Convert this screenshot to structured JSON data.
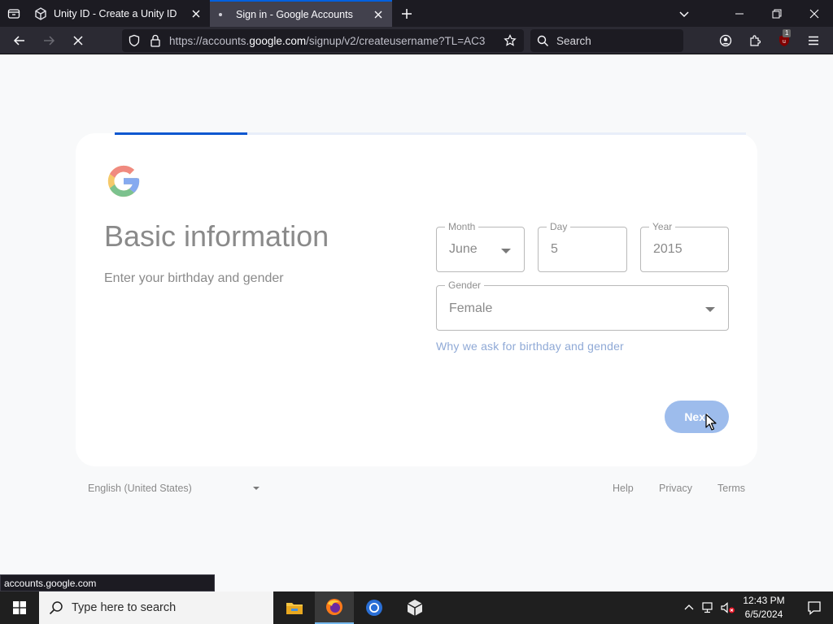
{
  "browser": {
    "tabs": [
      {
        "title": "Unity ID - Create a Unity ID",
        "icon": "unity-icon",
        "active": false
      },
      {
        "title": "Sign in - Google Accounts",
        "icon": "loading-dot-icon",
        "active": true
      }
    ],
    "url_prefix": "https://accounts.",
    "url_domain": "google.com",
    "url_suffix": "/signup/v2/createusername?TL=AC3",
    "search_placeholder": "Search",
    "extension_badge": "1",
    "status_url": "accounts.google.com"
  },
  "page": {
    "heading": "Basic information",
    "subheading": "Enter your birthday and gender",
    "progress_fraction": 0.21,
    "month": {
      "label": "Month",
      "value": "June"
    },
    "day": {
      "label": "Day",
      "value": "5"
    },
    "year": {
      "label": "Year",
      "value": "2015"
    },
    "gender": {
      "label": "Gender",
      "value": "Female"
    },
    "why_link": "Why we ask for birthday and gender",
    "next_label": "Next",
    "footer": {
      "language": "English (United States)",
      "help": "Help",
      "privacy": "Privacy",
      "terms": "Terms"
    }
  },
  "taskbar": {
    "search_text": "Type here to search",
    "time": "12:43 PM",
    "date": "6/5/2024"
  },
  "colors": {
    "google_blue": "#0b57d0",
    "button_disabled_blue": "#9dbcec",
    "link_blue": "#8fa9d6",
    "firefox_tab_active": "#42414d",
    "taskbar": "#1f1f1f"
  }
}
